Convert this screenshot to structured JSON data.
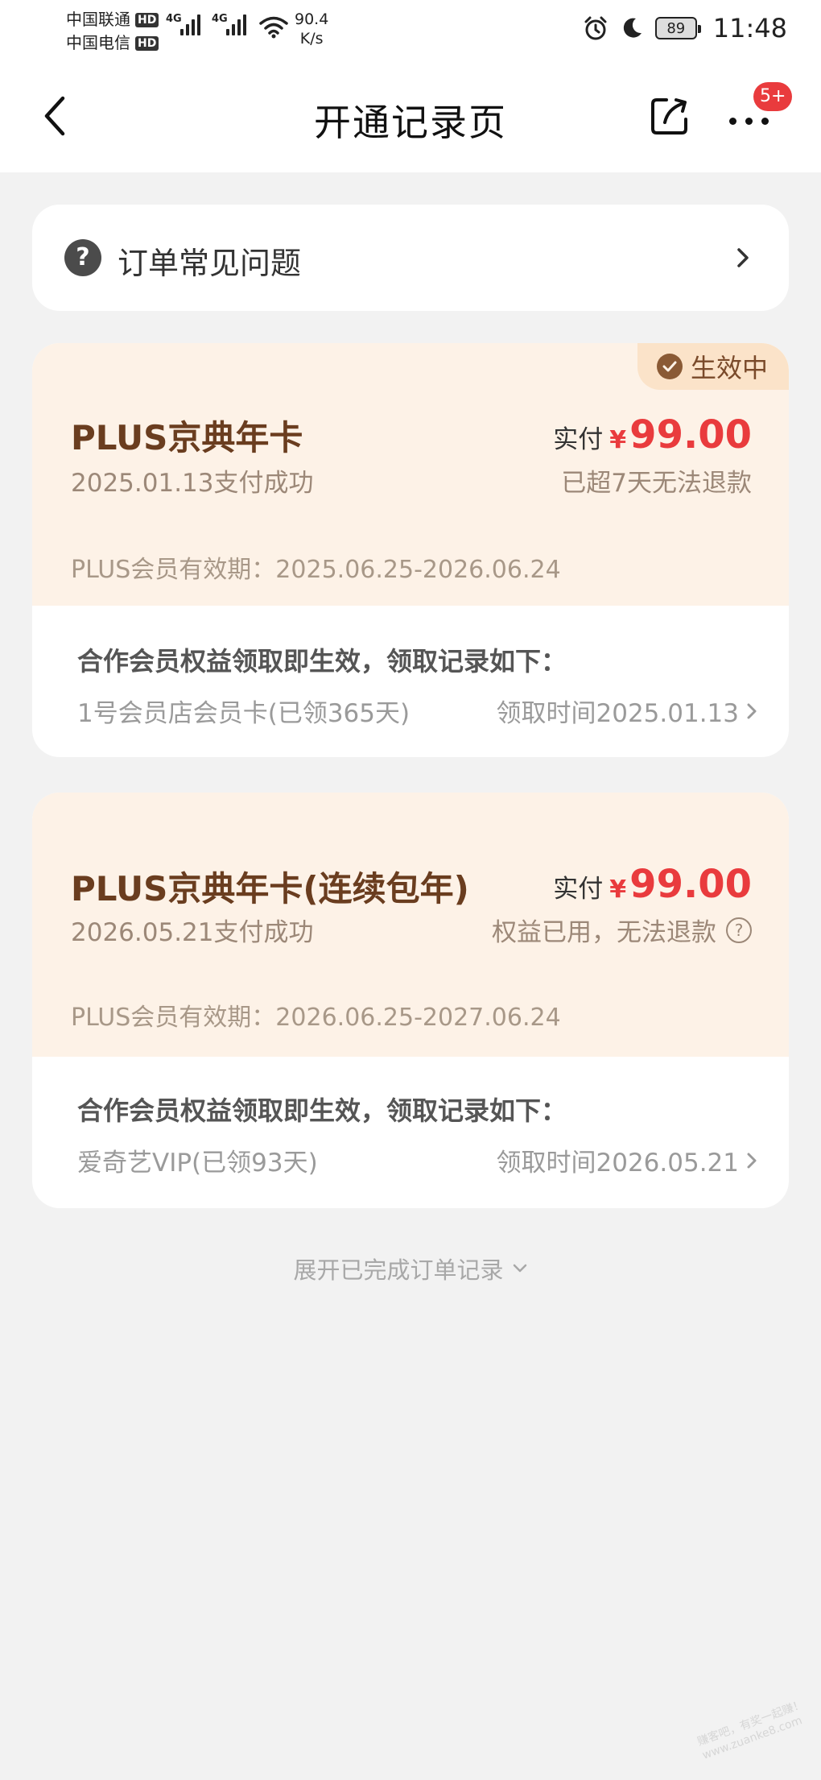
{
  "status_bar": {
    "carrier1": "中国联通",
    "carrier2": "中国电信",
    "hd": "HD",
    "net_type": "4G",
    "speed_value": "90.4",
    "speed_unit": "K/s",
    "battery": "89",
    "time": "11:48",
    "icons": [
      "alarm-icon",
      "moon-icon",
      "wifi-icon",
      "signal-icon",
      "battery-icon"
    ]
  },
  "nav": {
    "title": "开通记录页",
    "badge": "5+",
    "icons": [
      "back-chevron-icon",
      "share-icon",
      "more-dots-icon"
    ]
  },
  "faq": {
    "icon_glyph": "?",
    "label": "订单常见问题"
  },
  "orders": [
    {
      "status": "生效中",
      "name": "PLUS京典年卡",
      "pay_date": "2025.01.13支付成功",
      "price_prefix": "实付",
      "currency": "¥",
      "price": "99.00",
      "refund_note": "已超7天无法退款",
      "validity": "PLUS会员有效期：2025.06.25-2026.06.24",
      "benefit_title": "合作会员权益领取即生效，领取记录如下：",
      "benefit_name": "1号会员店会员卡(已领365天)",
      "benefit_time": "领取时间2025.01.13"
    },
    {
      "name": "PLUS京典年卡(连续包年)",
      "pay_date": "2026.05.21支付成功",
      "price_prefix": "实付",
      "currency": "¥",
      "price": "99.00",
      "refund_note": "权益已用，无法退款",
      "help_glyph": "?",
      "validity": "PLUS会员有效期：2026.06.25-2027.06.24",
      "benefit_title": "合作会员权益领取即生效，领取记录如下：",
      "benefit_name": "爱奇艺VIP(已领93天)",
      "benefit_time": "领取时间2026.05.21"
    }
  ],
  "footer": {
    "expand_label": "展开已完成订单记录"
  },
  "watermark": {
    "line1": "赚客吧，有奖一起赚！",
    "line2": "www.zuanke8.com"
  },
  "colors": {
    "accent_red": "#e93b3d",
    "card_top_bg": "#fdf2e7",
    "brown_text": "#6a3d1f",
    "page_bg": "#f2f2f2"
  }
}
